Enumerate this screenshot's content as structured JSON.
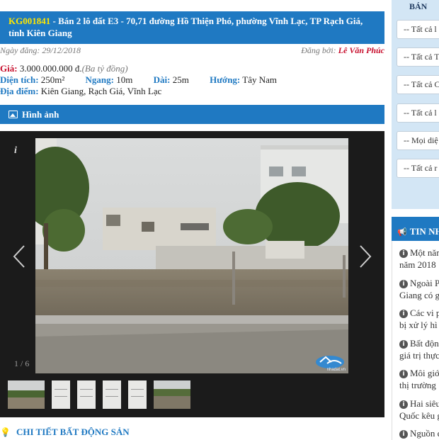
{
  "listing": {
    "code": "KG001841",
    "title_rest": " - Bán 2 lô đất E3 - 70,71 đường Hồ Thiện Phó, phường Vĩnh Lạc, TP Rạch Giá, tỉnh Kiên Giang",
    "post_date": "Ngày đăng: 29/12/2018",
    "posted_by_label": "Đăng bởi: ",
    "posted_by_name": "Lê Văn Phúc",
    "price_label": "Giá:",
    "price_value": "3.000.000.000 đ.",
    "price_words": "(Ba tỷ đồng)",
    "area_label": "Diện tích:",
    "area_value": "250m²",
    "width_label": "Ngang:",
    "width_value": "10m",
    "length_label": "Dài:",
    "length_value": "25m",
    "direction_label": "Hướng:",
    "direction_value": "Tây Nam",
    "location_label": "Địa điểm:",
    "location_value": "Kiên Giang, Rạch Giá, Vĩnh Lạc"
  },
  "gallery": {
    "section_title": "Hình ảnh",
    "info_button": "i",
    "counter": "1 / 6",
    "watermark": "nhadat.vn",
    "thumbnail_count": 6
  },
  "detail_section_title": "CHI TIẾT BẤT ĐỘNG SẢN",
  "search_panel": {
    "title": "BÁN",
    "selects": [
      "-- Tất cả l",
      "-- Tất cả T",
      "-- Tất cả C",
      "-- Tất cả l",
      "-- Mọi diệ",
      "-- Tất cả r"
    ]
  },
  "news": {
    "header": "TIN NH",
    "items": [
      {
        "line1": "Một năm",
        "line2": "năm 2018"
      },
      {
        "line1": "Ngoài P",
        "line2": "Giang có g"
      },
      {
        "line1": "Các vi p",
        "line2": "bị xử lý hì"
      },
      {
        "line1": "Bất độn",
        "line2": "giá trị thực"
      },
      {
        "line1": "Môi giớ",
        "line2": "thị trường"
      },
      {
        "line1": "Hai siêu",
        "line2": "Quốc kêu g"
      },
      {
        "line1": "Nguồn c",
        "line2": ""
      }
    ]
  },
  "colors": {
    "primary_blue": "#1f79c2",
    "code_yellow": "#ffe600",
    "label_red": "#c8102e",
    "panel_light_blue": "#d3e6f5"
  }
}
